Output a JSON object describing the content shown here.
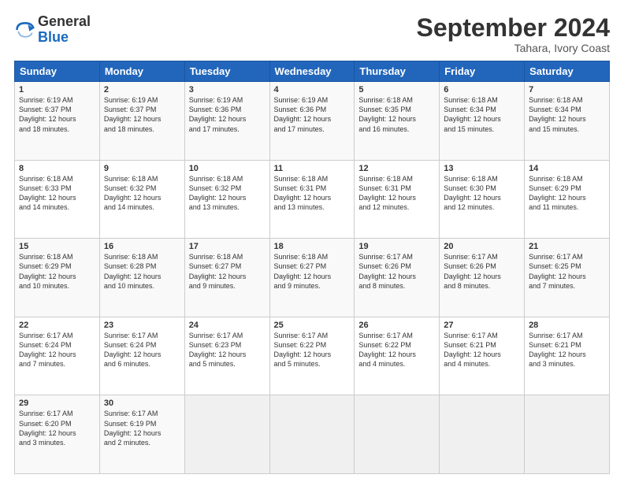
{
  "logo": {
    "general": "General",
    "blue": "Blue"
  },
  "title": "September 2024",
  "location": "Tahara, Ivory Coast",
  "days_of_week": [
    "Sunday",
    "Monday",
    "Tuesday",
    "Wednesday",
    "Thursday",
    "Friday",
    "Saturday"
  ],
  "weeks": [
    [
      {
        "day": "1",
        "sunrise": "6:19 AM",
        "sunset": "6:37 PM",
        "daylight": "12 hours and 18 minutes."
      },
      {
        "day": "2",
        "sunrise": "6:19 AM",
        "sunset": "6:37 PM",
        "daylight": "12 hours and 18 minutes."
      },
      {
        "day": "3",
        "sunrise": "6:19 AM",
        "sunset": "6:36 PM",
        "daylight": "12 hours and 17 minutes."
      },
      {
        "day": "4",
        "sunrise": "6:19 AM",
        "sunset": "6:36 PM",
        "daylight": "12 hours and 17 minutes."
      },
      {
        "day": "5",
        "sunrise": "6:18 AM",
        "sunset": "6:35 PM",
        "daylight": "12 hours and 16 minutes."
      },
      {
        "day": "6",
        "sunrise": "6:18 AM",
        "sunset": "6:34 PM",
        "daylight": "12 hours and 15 minutes."
      },
      {
        "day": "7",
        "sunrise": "6:18 AM",
        "sunset": "6:34 PM",
        "daylight": "12 hours and 15 minutes."
      }
    ],
    [
      {
        "day": "8",
        "sunrise": "6:18 AM",
        "sunset": "6:33 PM",
        "daylight": "12 hours and 14 minutes."
      },
      {
        "day": "9",
        "sunrise": "6:18 AM",
        "sunset": "6:32 PM",
        "daylight": "12 hours and 14 minutes."
      },
      {
        "day": "10",
        "sunrise": "6:18 AM",
        "sunset": "6:32 PM",
        "daylight": "12 hours and 13 minutes."
      },
      {
        "day": "11",
        "sunrise": "6:18 AM",
        "sunset": "6:31 PM",
        "daylight": "12 hours and 13 minutes."
      },
      {
        "day": "12",
        "sunrise": "6:18 AM",
        "sunset": "6:31 PM",
        "daylight": "12 hours and 12 minutes."
      },
      {
        "day": "13",
        "sunrise": "6:18 AM",
        "sunset": "6:30 PM",
        "daylight": "12 hours and 12 minutes."
      },
      {
        "day": "14",
        "sunrise": "6:18 AM",
        "sunset": "6:29 PM",
        "daylight": "12 hours and 11 minutes."
      }
    ],
    [
      {
        "day": "15",
        "sunrise": "6:18 AM",
        "sunset": "6:29 PM",
        "daylight": "12 hours and 10 minutes."
      },
      {
        "day": "16",
        "sunrise": "6:18 AM",
        "sunset": "6:28 PM",
        "daylight": "12 hours and 10 minutes."
      },
      {
        "day": "17",
        "sunrise": "6:18 AM",
        "sunset": "6:27 PM",
        "daylight": "12 hours and 9 minutes."
      },
      {
        "day": "18",
        "sunrise": "6:18 AM",
        "sunset": "6:27 PM",
        "daylight": "12 hours and 9 minutes."
      },
      {
        "day": "19",
        "sunrise": "6:17 AM",
        "sunset": "6:26 PM",
        "daylight": "12 hours and 8 minutes."
      },
      {
        "day": "20",
        "sunrise": "6:17 AM",
        "sunset": "6:26 PM",
        "daylight": "12 hours and 8 minutes."
      },
      {
        "day": "21",
        "sunrise": "6:17 AM",
        "sunset": "6:25 PM",
        "daylight": "12 hours and 7 minutes."
      }
    ],
    [
      {
        "day": "22",
        "sunrise": "6:17 AM",
        "sunset": "6:24 PM",
        "daylight": "12 hours and 7 minutes."
      },
      {
        "day": "23",
        "sunrise": "6:17 AM",
        "sunset": "6:24 PM",
        "daylight": "12 hours and 6 minutes."
      },
      {
        "day": "24",
        "sunrise": "6:17 AM",
        "sunset": "6:23 PM",
        "daylight": "12 hours and 5 minutes."
      },
      {
        "day": "25",
        "sunrise": "6:17 AM",
        "sunset": "6:22 PM",
        "daylight": "12 hours and 5 minutes."
      },
      {
        "day": "26",
        "sunrise": "6:17 AM",
        "sunset": "6:22 PM",
        "daylight": "12 hours and 4 minutes."
      },
      {
        "day": "27",
        "sunrise": "6:17 AM",
        "sunset": "6:21 PM",
        "daylight": "12 hours and 4 minutes."
      },
      {
        "day": "28",
        "sunrise": "6:17 AM",
        "sunset": "6:21 PM",
        "daylight": "12 hours and 3 minutes."
      }
    ],
    [
      {
        "day": "29",
        "sunrise": "6:17 AM",
        "sunset": "6:20 PM",
        "daylight": "12 hours and 3 minutes."
      },
      {
        "day": "30",
        "sunrise": "6:17 AM",
        "sunset": "6:19 PM",
        "daylight": "12 hours and 2 minutes."
      },
      null,
      null,
      null,
      null,
      null
    ]
  ],
  "labels": {
    "sunrise": "Sunrise:",
    "sunset": "Sunset:",
    "daylight": "Daylight:"
  }
}
